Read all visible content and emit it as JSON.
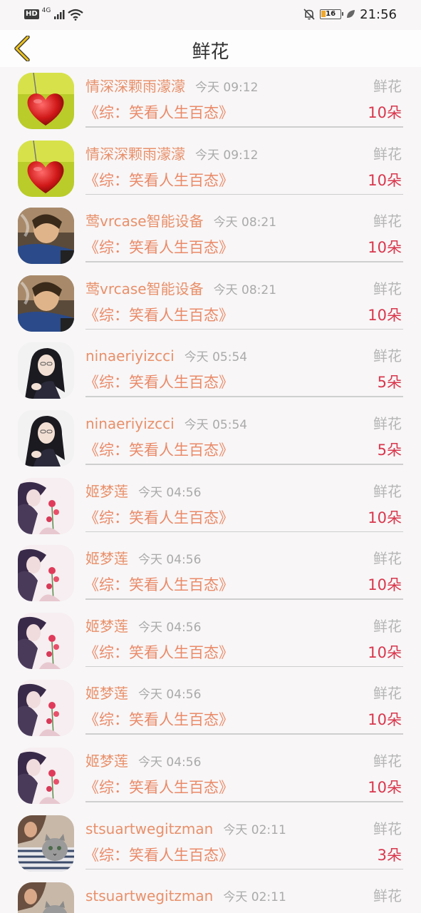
{
  "status_bar": {
    "hd": "HD",
    "network": "4G",
    "battery": "16",
    "time": "21:56"
  },
  "header": {
    "title": "鲜花"
  },
  "icons": {
    "back": "chevron-left-icon",
    "signal": "signal-icon",
    "wifi": "wifi-icon",
    "mute": "bell-off-icon",
    "leaf": "leaf-icon"
  },
  "colors": {
    "username": "#e8906a",
    "count": "#d9374d",
    "back": "#f0c419"
  },
  "rows": [
    {
      "user": "情深深颗雨濛濛",
      "time": "今天 09:12",
      "type": "鲜花",
      "book": "《综：笑看人生百态》",
      "count": "10朵",
      "avatar": "heart"
    },
    {
      "user": "情深深颗雨濛濛",
      "time": "今天 09:12",
      "type": "鲜花",
      "book": "《综：笑看人生百态》",
      "count": "10朵",
      "avatar": "heart"
    },
    {
      "user": "莺vrcase智能设备",
      "time": "今天 08:21",
      "type": "鲜花",
      "book": "《综：笑看人生百态》",
      "count": "10朵",
      "avatar": "smoke"
    },
    {
      "user": "莺vrcase智能设备",
      "time": "今天 08:21",
      "type": "鲜花",
      "book": "《综：笑看人生百态》",
      "count": "10朵",
      "avatar": "smoke"
    },
    {
      "user": "ninaeriyizcci",
      "time": "今天 05:54",
      "type": "鲜花",
      "book": "《综：笑看人生百态》",
      "count": "5朵",
      "avatar": "girl"
    },
    {
      "user": "ninaeriyizcci",
      "time": "今天 05:54",
      "type": "鲜花",
      "book": "《综：笑看人生百态》",
      "count": "5朵",
      "avatar": "girl"
    },
    {
      "user": "姬梦莲",
      "time": "今天 04:56",
      "type": "鲜花",
      "book": "《综：笑看人生百态》",
      "count": "10朵",
      "avatar": "flower"
    },
    {
      "user": "姬梦莲",
      "time": "今天 04:56",
      "type": "鲜花",
      "book": "《综：笑看人生百态》",
      "count": "10朵",
      "avatar": "flower"
    },
    {
      "user": "姬梦莲",
      "time": "今天 04:56",
      "type": "鲜花",
      "book": "《综：笑看人生百态》",
      "count": "10朵",
      "avatar": "flower"
    },
    {
      "user": "姬梦莲",
      "time": "今天 04:56",
      "type": "鲜花",
      "book": "《综：笑看人生百态》",
      "count": "10朵",
      "avatar": "flower"
    },
    {
      "user": "姬梦莲",
      "time": "今天 04:56",
      "type": "鲜花",
      "book": "《综：笑看人生百态》",
      "count": "10朵",
      "avatar": "flower"
    },
    {
      "user": "stsuartwegitzman",
      "time": "今天 02:11",
      "type": "鲜花",
      "book": "《综：笑看人生百态》",
      "count": "3朵",
      "avatar": "cat"
    },
    {
      "user": "stsuartwegitzman",
      "time": "今天 02:11",
      "type": "鲜花",
      "book": "",
      "count": "",
      "avatar": "cat"
    }
  ]
}
